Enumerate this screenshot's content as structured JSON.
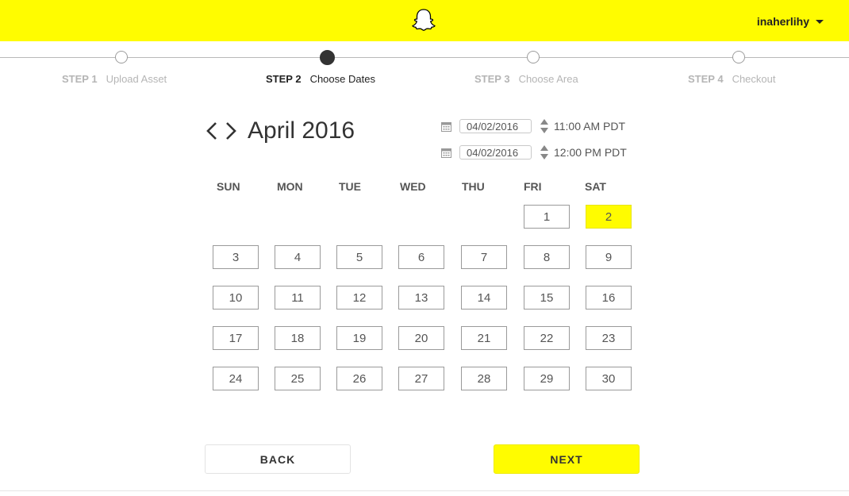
{
  "header": {
    "username": "inaherlihy",
    "brand_color": "#fffc00",
    "logo_icon": "ghost-icon"
  },
  "steps": [
    {
      "number": "STEP 1",
      "label": "Upload Asset",
      "state": "done"
    },
    {
      "number": "STEP 2",
      "label": "Choose Dates",
      "state": "active"
    },
    {
      "number": "STEP 3",
      "label": "Choose Area",
      "state": "upcoming"
    },
    {
      "number": "STEP 4",
      "label": "Checkout",
      "state": "upcoming"
    }
  ],
  "calendar": {
    "month_label": "April 2016",
    "weekdays": [
      "SUN",
      "MON",
      "TUE",
      "WED",
      "THU",
      "FRI",
      "SAT"
    ],
    "weeks": [
      [
        "",
        "",
        "",
        "",
        "",
        "1",
        "2"
      ],
      [
        "3",
        "4",
        "5",
        "6",
        "7",
        "8",
        "9"
      ],
      [
        "10",
        "11",
        "12",
        "13",
        "14",
        "15",
        "16"
      ],
      [
        "17",
        "18",
        "19",
        "20",
        "21",
        "22",
        "23"
      ],
      [
        "24",
        "25",
        "26",
        "27",
        "28",
        "29",
        "30"
      ]
    ],
    "selected_day": "2"
  },
  "start": {
    "date": "04/02/2016",
    "time": "11:00  AM PDT"
  },
  "end": {
    "date": "04/02/2016",
    "time": "12:00  PM PDT"
  },
  "buttons": {
    "back": "BACK",
    "next": "NEXT"
  }
}
